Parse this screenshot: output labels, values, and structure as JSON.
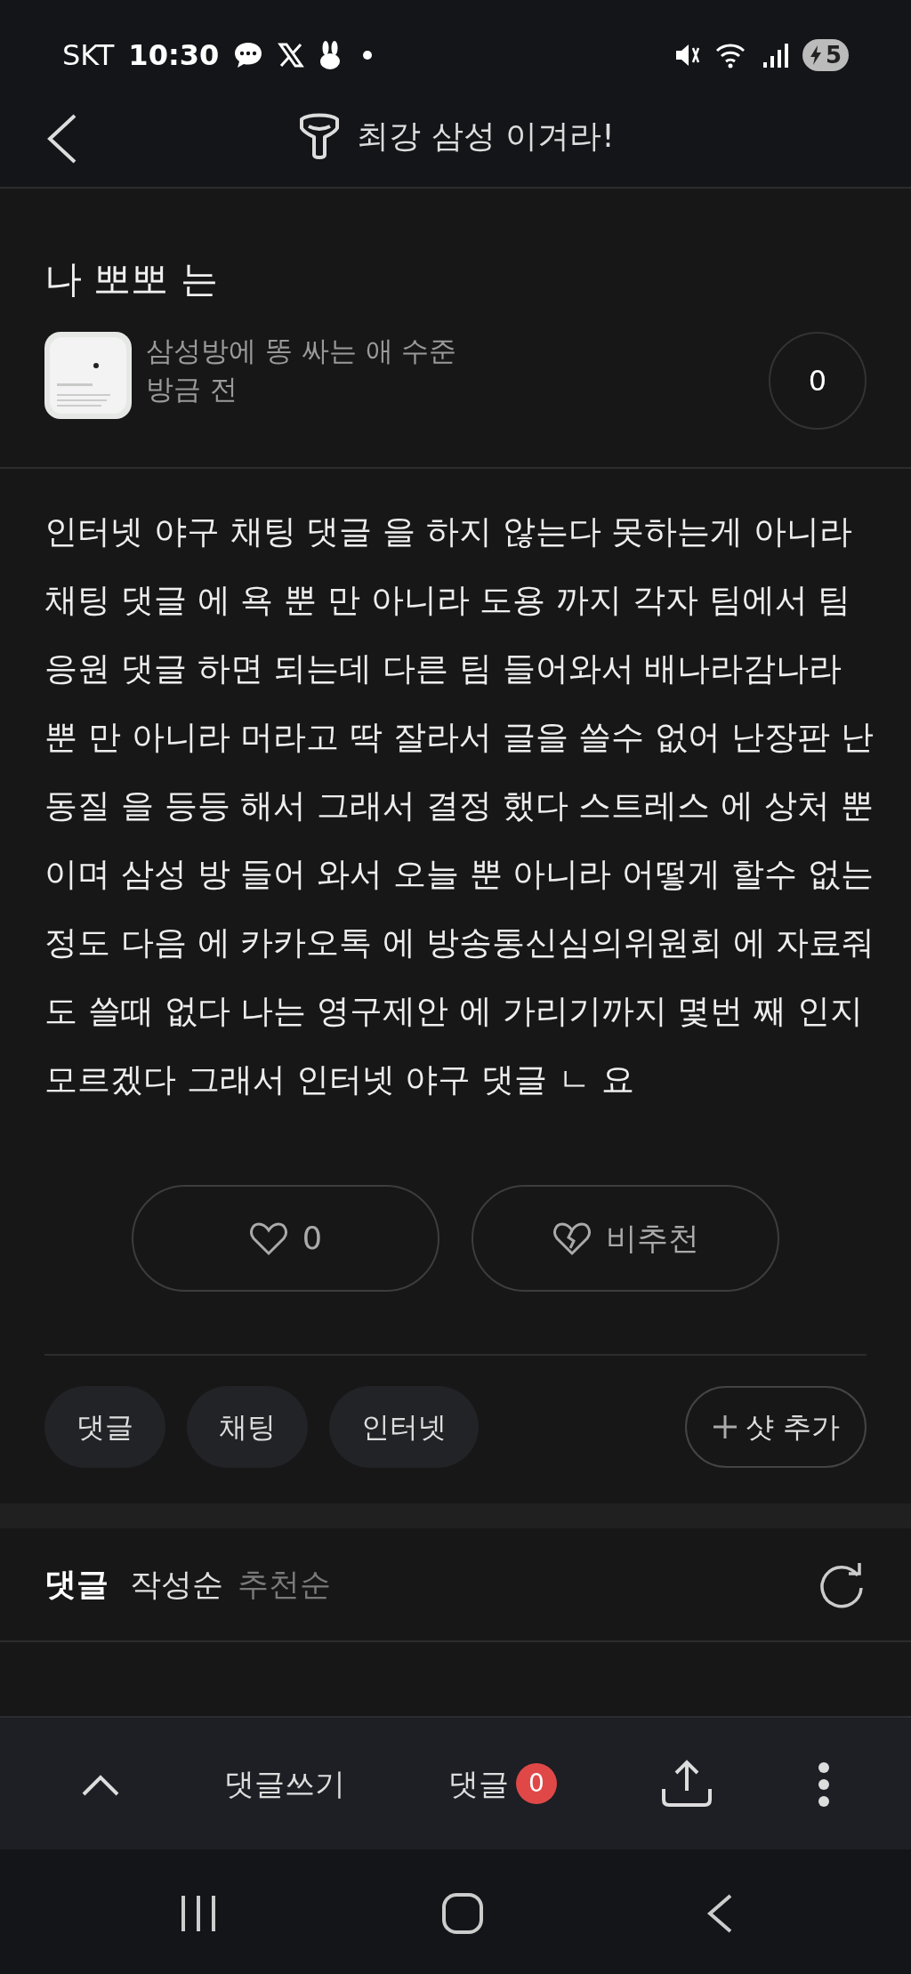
{
  "status_bar": {
    "carrier": "SKT",
    "time": "10:30",
    "battery": "5"
  },
  "header": {
    "title": "최강 삼성 이겨라!"
  },
  "post": {
    "title": "나 뽀뽀 는",
    "author": "삼성방에 똥 싸는 애 수준",
    "time": "방금 전",
    "view_count": "0",
    "body": "인터넷 야구 채팅 댓글 을 하지 않는다 못하는게 아니라 채팅 댓글 에 욕 뿐 만 아니라 도용 까지 각자 팀에서 팀 응원 댓글 하면 되는데 다른 팀 들어와서 배나라감나라 뿐 만 아니라 머라고 딱 잘라서 글을 쓸수 없어 난장판 난동질 을 등등 해서 그래서 결정 했다 스트레스 에 상처 뿐 이며 삼성 방 들어 와서 오늘 뿐 아니라 어떻게 할수 없는정도 다음 에 카카오톡 에 방송통신심의위원회 에 자료줘도 쓸때 없다 나는 영구제안 에 가리기까지 몇번 째 인지 모르겠다 그래서 인터넷 야구 댓글 ㄴ 요",
    "like_count": "0",
    "dislike_label": "비추천",
    "tags": [
      "댓글",
      "채팅",
      "인터넷"
    ],
    "add_tag": "샷 추가"
  },
  "comments": {
    "heading": "댓글",
    "sorts": [
      {
        "label": "작성순",
        "selected": true
      },
      {
        "label": "추천순",
        "selected": false
      }
    ]
  },
  "bottom_bar": {
    "write": "댓글쓰기",
    "comments": "댓글",
    "comment_count": "0"
  }
}
